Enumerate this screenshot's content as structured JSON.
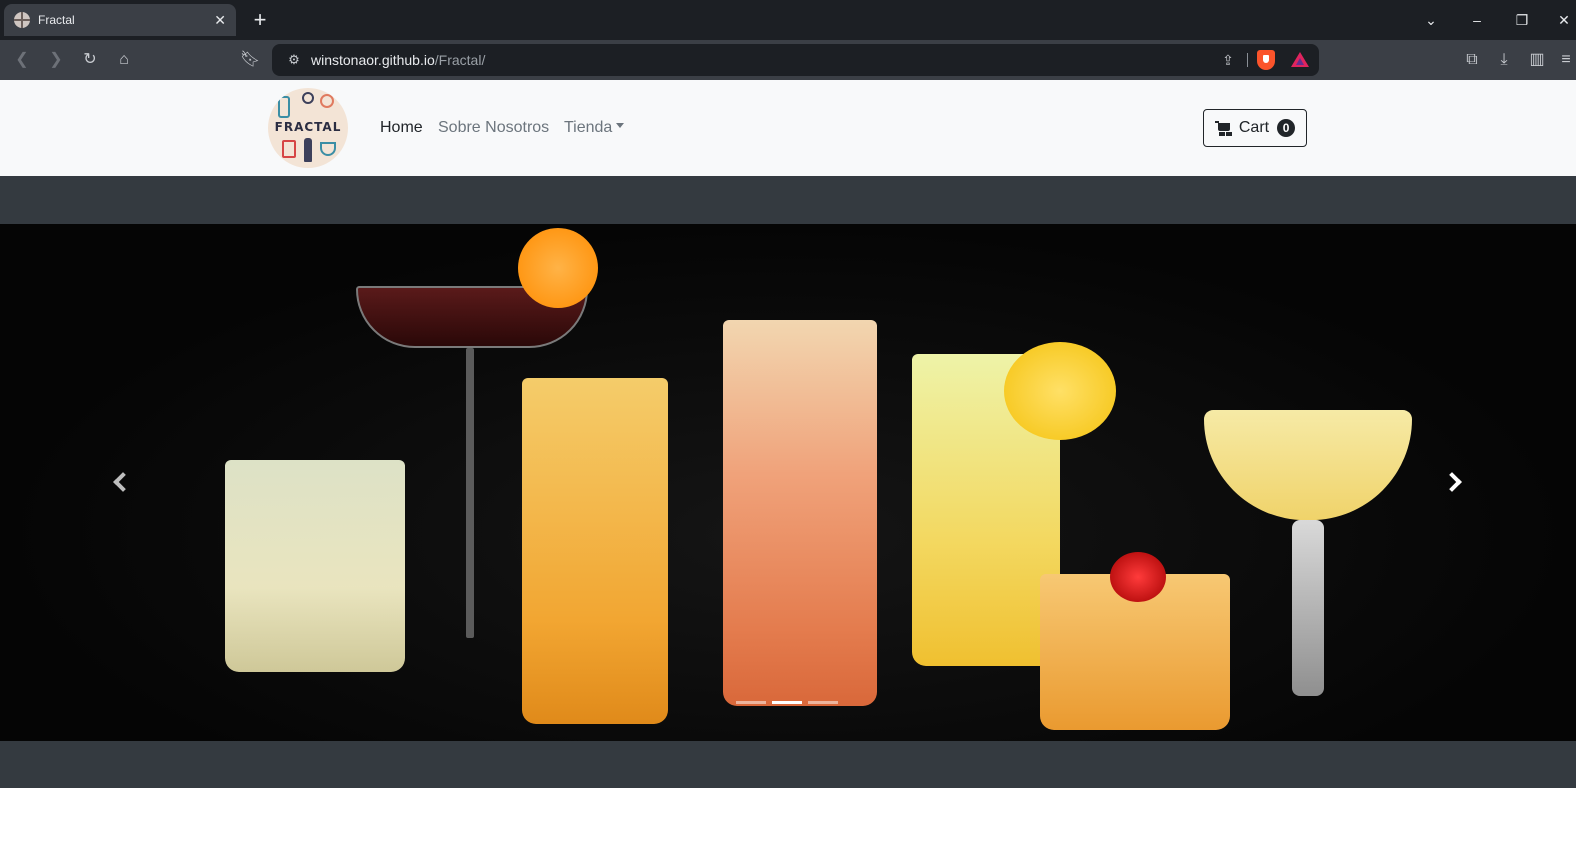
{
  "browser": {
    "tab_title": "Fractal",
    "tab_close": "✕",
    "new_tab": "+",
    "url_host": "winstonaor.github.io",
    "url_path": "/Fractal/"
  },
  "site": {
    "logo_text": "FRACTAL",
    "nav": {
      "home": "Home",
      "about": "Sobre Nosotros",
      "shop": "Tienda"
    },
    "cart": {
      "label": "Cart",
      "count": "0"
    }
  },
  "colors": {
    "navbar_bg": "#f8f9fa",
    "header_bg": "#343a40",
    "cart_badge": "#212529"
  },
  "carousel": {
    "slide_count": 3,
    "active_slide": 2
  }
}
